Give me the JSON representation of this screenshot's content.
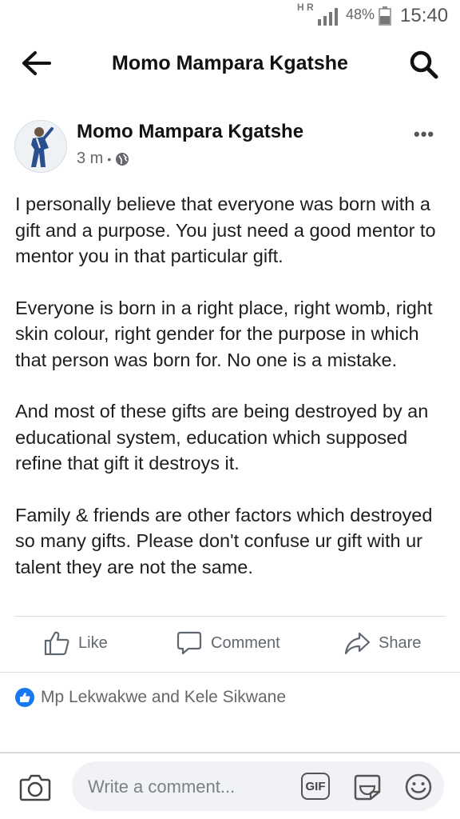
{
  "status_bar": {
    "network_top": "H",
    "network_second": "R",
    "battery_percent": "48%",
    "time": "15:40"
  },
  "header": {
    "title": "Momo Mampara Kgatshe",
    "back_icon": "arrow-left-icon",
    "search_icon": "search-icon"
  },
  "post": {
    "author": "Momo Mampara Kgatshe",
    "time_ago": "3 m",
    "privacy_icon": "globe-icon",
    "paragraphs": [
      "I personally believe that everyone was born with a gift and a purpose. You just need a good mentor to mentor you in that particular gift.",
      "Everyone is born in a right place, right womb, right skin colour, right gender for the purpose in which that person was born for. No one is a mistake.",
      "And most of these gifts are being destroyed by an educational system, education which supposed refine that gift it destroys it.",
      "Family & friends are other factors which destroyed so many gifts. Please don't confuse ur gift with ur talent they are not the same."
    ]
  },
  "actions": {
    "like_label": "Like",
    "comment_label": "Comment",
    "share_label": "Share"
  },
  "reactions": {
    "names": "Mp Lekwakwe and Kele Sikwane"
  },
  "composer": {
    "placeholder": "Write a comment...",
    "gif_label": "GIF"
  },
  "colors": {
    "accent": "#1877f2",
    "text": "#1c1e21",
    "secondary_text": "#65676b",
    "composer_bg": "#f0f2f5"
  }
}
